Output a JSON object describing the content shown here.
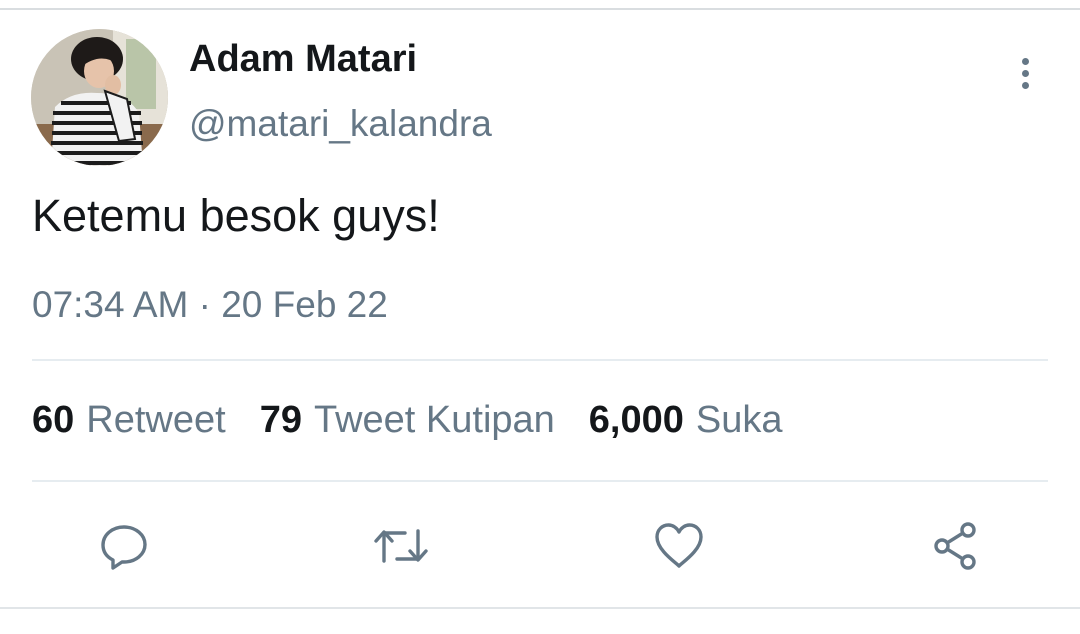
{
  "tweet": {
    "author": {
      "display_name": "Adam Matari",
      "handle": "@matari_kalandra",
      "avatar_icon": "avatar-photo"
    },
    "text": "Ketemu besok guys!",
    "timestamp": "07:34 AM · 20 Feb 22",
    "stats": [
      {
        "count": "60",
        "label": "Retweet"
      },
      {
        "count": "79",
        "label": "Tweet Kutipan"
      },
      {
        "count": "6,000",
        "label": "Suka"
      }
    ],
    "actions": [
      {
        "name": "reply",
        "icon": "speech-bubble-icon"
      },
      {
        "name": "retweet",
        "icon": "retweet-arrows-icon"
      },
      {
        "name": "like",
        "icon": "heart-icon"
      },
      {
        "name": "share",
        "icon": "share-nodes-icon"
      }
    ]
  },
  "colors": {
    "text_primary": "#14171a",
    "text_secondary": "#657786",
    "divider": "#e6ecf0",
    "icon": "#657786"
  }
}
